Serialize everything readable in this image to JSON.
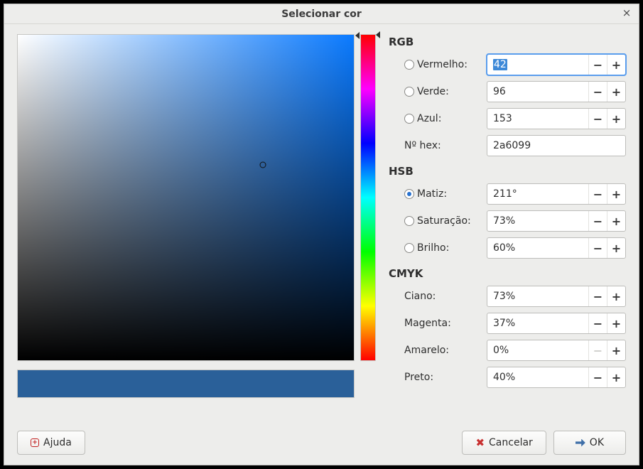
{
  "window": {
    "title": "Selecionar cor",
    "close_tooltip": "Close"
  },
  "current_color_hex": "#2a6099",
  "sections": {
    "rgb": {
      "title": "RGB",
      "red_label": "Vermelho:",
      "green_label": "Verde:",
      "blue_label": "Azul:",
      "hex_label": "Nº hex:",
      "red_value": "42",
      "green_value": "96",
      "blue_value": "153",
      "hex_value": "2a6099"
    },
    "hsb": {
      "title": "HSB",
      "hue_label": "Matiz:",
      "sat_label": "Saturação:",
      "bri_label": "Brilho:",
      "hue_value": "211°",
      "sat_value": "73%",
      "bri_value": "60%"
    },
    "cmyk": {
      "title": "CMYK",
      "cyan_label": "Ciano:",
      "magenta_label": "Magenta:",
      "yellow_label": "Amarelo:",
      "black_label": "Preto:",
      "cyan_value": "73%",
      "magenta_value": "37%",
      "yellow_value": "0%",
      "black_value": "40%"
    }
  },
  "selected_radio": "hue",
  "buttons": {
    "help": "Ajuda",
    "cancel": "Cancelar",
    "ok": "OK"
  }
}
